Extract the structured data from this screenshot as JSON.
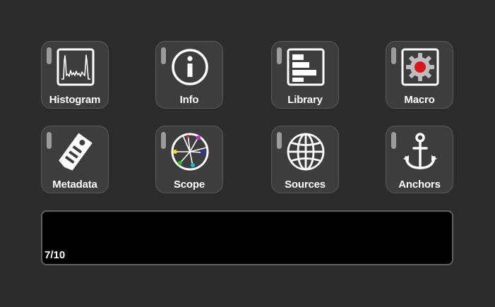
{
  "buttons": [
    {
      "label": "Histogram",
      "icon": "histogram-icon"
    },
    {
      "label": "Info",
      "icon": "info-icon"
    },
    {
      "label": "Library",
      "icon": "library-icon"
    },
    {
      "label": "Macro",
      "icon": "gear-icon"
    },
    {
      "label": "Metadata",
      "icon": "tag-icon"
    },
    {
      "label": "Scope",
      "icon": "vectorscope-icon"
    },
    {
      "label": "Sources",
      "icon": "globe-icon"
    },
    {
      "label": "Anchors",
      "icon": "anchor-icon"
    }
  ],
  "display": {
    "page": "7/10"
  },
  "colors": {
    "background": "#2b2b2b",
    "tile": "#3d3d3d",
    "led": "#9c9c9c",
    "display": "#000000",
    "macro_dot": "#d8141c"
  }
}
